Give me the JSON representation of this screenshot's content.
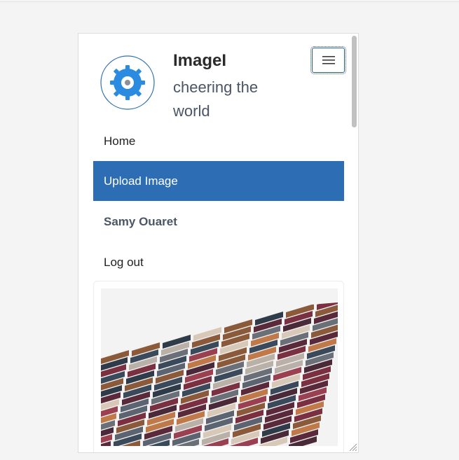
{
  "brand": {
    "title": "ImageI",
    "tagline": "cheering the world"
  },
  "nav": {
    "items": [
      {
        "label": "Home"
      },
      {
        "label": "Upload Image"
      },
      {
        "label": "Samy Ouaret"
      },
      {
        "label": "Log out"
      }
    ],
    "active_index": 1
  },
  "colors": {
    "accent": "#2d6db3",
    "logo_blue": "#2b8be0",
    "page_bg": "#f4f4f4"
  },
  "icons": {
    "logo": "gear-logo-icon",
    "menu": "hamburger-icon",
    "resize": "resize-handle-icon"
  }
}
